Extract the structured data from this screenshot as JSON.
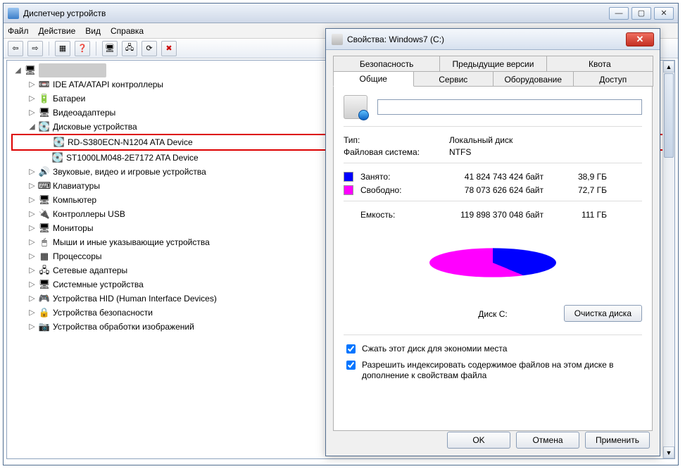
{
  "dm": {
    "title": "Диспетчер устройств",
    "menu": {
      "file": "Файл",
      "action": "Действие",
      "view": "Вид",
      "help": "Справка"
    },
    "root": "",
    "nodes": {
      "ide": "IDE ATA/ATAPI контроллеры",
      "batt": "Батареи",
      "video": "Видеоадаптеры",
      "disk": "Дисковые устройства",
      "disk_child1": "RD-S380ECN-N1204 ATA Device",
      "disk_child2": "ST1000LM048-2E7172 ATA Device",
      "sound": "Звуковые, видео и игровые устройства",
      "kbd": "Клавиатуры",
      "pc": "Компьютер",
      "usb": "Контроллеры USB",
      "mon": "Мониторы",
      "mouse": "Мыши и иные указывающие устройства",
      "cpu": "Процессоры",
      "net": "Сетевые адаптеры",
      "sys": "Системные устройства",
      "hid": "Устройства HID (Human Interface Devices)",
      "sec": "Устройства безопасности",
      "img": "Устройства обработки изображений"
    }
  },
  "prop": {
    "title": "Свойства: Windows7 (C:)",
    "tabs": {
      "security": "Безопасность",
      "prev": "Предыдущие версии",
      "quota": "Квота",
      "general": "Общие",
      "tools": "Сервис",
      "hardware": "Оборудование",
      "sharing": "Доступ"
    },
    "driveNameValue": "",
    "type_label": "Тип:",
    "type_value": "Локальный диск",
    "fs_label": "Файловая система:",
    "fs_value": "NTFS",
    "used_label": "Занято:",
    "used_bytes": "41 824 743 424 байт",
    "used_human": "38,9 ГБ",
    "free_label": "Свободно:",
    "free_bytes": "78 073 626 624 байт",
    "free_human": "72,7 ГБ",
    "cap_label": "Емкость:",
    "cap_bytes": "119 898 370 048 байт",
    "cap_human": "111 ГБ",
    "disk_caption": "Диск C:",
    "cleanup": "Очистка диска",
    "compress": "Сжать этот диск для экономии места",
    "index": "Разрешить индексировать содержимое файлов на этом диске в дополнение к свойствам файла",
    "ok": "OK",
    "cancel": "Отмена",
    "apply": "Применить"
  }
}
